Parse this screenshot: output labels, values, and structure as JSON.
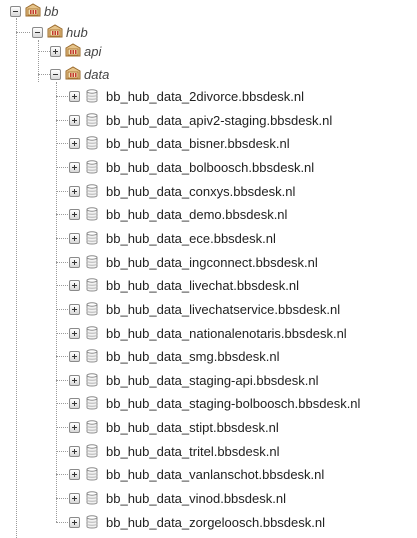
{
  "tree": {
    "root": {
      "label": "bb"
    },
    "hub": {
      "label": "hub"
    },
    "api": {
      "label": "api"
    },
    "data": {
      "label": "data"
    },
    "databases": [
      "bb_hub_data_2divorce.bbsdesk.nl",
      "bb_hub_data_apiv2-staging.bbsdesk.nl",
      "bb_hub_data_bisner.bbsdesk.nl",
      "bb_hub_data_bolboosch.bbsdesk.nl",
      "bb_hub_data_conxys.bbsdesk.nl",
      "bb_hub_data_demo.bbsdesk.nl",
      "bb_hub_data_ece.bbsdesk.nl",
      "bb_hub_data_ingconnect.bbsdesk.nl",
      "bb_hub_data_livechat.bbsdesk.nl",
      "bb_hub_data_livechatservice.bbsdesk.nl",
      "bb_hub_data_nationalenotaris.bbsdesk.nl",
      "bb_hub_data_smg.bbsdesk.nl",
      "bb_hub_data_staging-api.bbsdesk.nl",
      "bb_hub_data_staging-bolboosch.bbsdesk.nl",
      "bb_hub_data_stipt.bbsdesk.nl",
      "bb_hub_data_tritel.bbsdesk.nl",
      "bb_hub_data_vanlanschot.bbsdesk.nl",
      "bb_hub_data_vinod.bbsdesk.nl",
      "bb_hub_data_zorgeloosch.bbsdesk.nl"
    ]
  },
  "icons": {
    "group": "group-folder-icon",
    "database": "database-icon"
  }
}
